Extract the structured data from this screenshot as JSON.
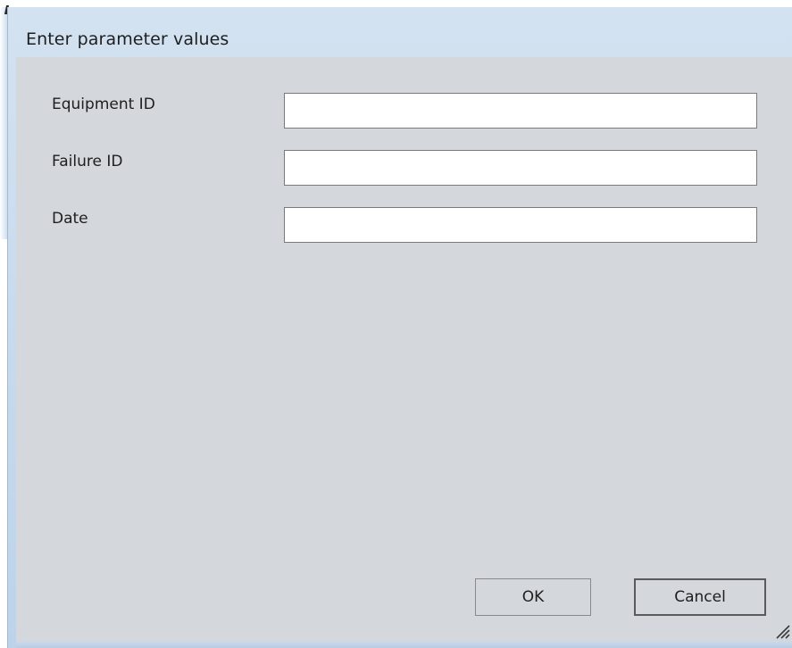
{
  "dialog": {
    "title": "Enter parameter values"
  },
  "fields": [
    {
      "label": "Equipment ID",
      "value": "",
      "placeholder": ""
    },
    {
      "label": "Failure ID",
      "value": "",
      "placeholder": ""
    },
    {
      "label": "Date",
      "value": "",
      "placeholder": ""
    }
  ],
  "buttons": {
    "ok_label": "OK",
    "cancel_label": "Cancel"
  },
  "icons": {
    "resize_grip": "resize-grip-icon"
  },
  "colors": {
    "titlebar": "#c8dbee",
    "client_background": "#d4d8dc",
    "input_background": "#ffffff",
    "input_border": "#7a7a7a"
  }
}
